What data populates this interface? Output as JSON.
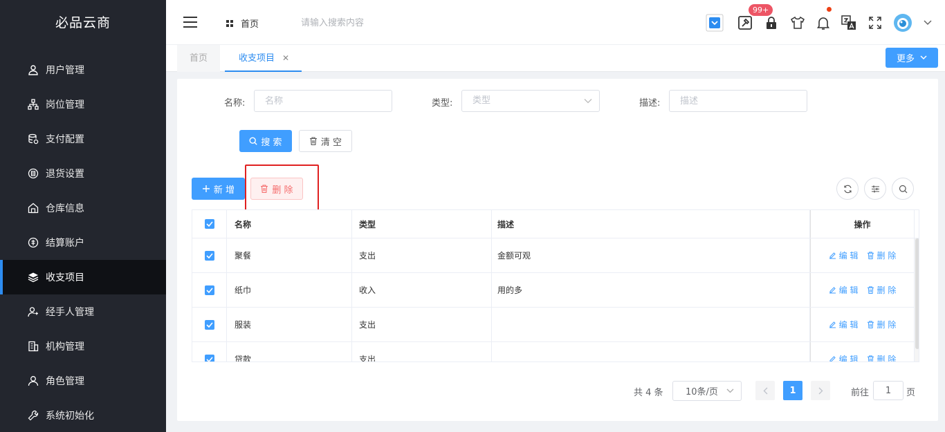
{
  "brand": "必品云商",
  "sidebar": {
    "items": [
      {
        "label": "用户管理",
        "icon": "user-icon"
      },
      {
        "label": "岗位管理",
        "icon": "org-icon"
      },
      {
        "label": "支付配置",
        "icon": "database-icon"
      },
      {
        "label": "退货设置",
        "icon": "return-icon"
      },
      {
        "label": "仓库信息",
        "icon": "warehouse-icon"
      },
      {
        "label": "结算账户",
        "icon": "account-icon"
      },
      {
        "label": "收支项目",
        "icon": "layers-icon",
        "active": true
      },
      {
        "label": "经手人管理",
        "icon": "handler-icon"
      },
      {
        "label": "机构管理",
        "icon": "building-icon"
      },
      {
        "label": "角色管理",
        "icon": "role-icon"
      },
      {
        "label": "系统初始化",
        "icon": "wrench-icon"
      }
    ]
  },
  "header": {
    "breadcrumb": "首页",
    "search_placeholder": "请输入搜索内容",
    "badge": "99+"
  },
  "tabs": {
    "items": [
      "首页",
      "收支项目"
    ],
    "active": "收支项目",
    "more_label": "更多"
  },
  "filters": {
    "name_label": "名称:",
    "name_placeholder": "名称",
    "type_label": "类型:",
    "type_placeholder": "类型",
    "desc_label": "描述:",
    "desc_placeholder": "描述",
    "search_button": "搜 索",
    "clear_button": "清 空"
  },
  "toolbar": {
    "add_button": "新 增",
    "delete_button": "删 除"
  },
  "table": {
    "columns": [
      "名称",
      "类型",
      "描述",
      "操作"
    ],
    "rows": [
      {
        "name": "聚餐",
        "type": "支出",
        "desc": "金额可观"
      },
      {
        "name": "纸巾",
        "type": "收入",
        "desc": "用的多"
      },
      {
        "name": "服装",
        "type": "支出",
        "desc": ""
      },
      {
        "name": "贷款",
        "type": "支出",
        "desc": ""
      }
    ],
    "edit_label": "编 辑",
    "delete_label": "删 除"
  },
  "pagination": {
    "total": "共 4 条",
    "page_size": "10条/页",
    "current_page": "1",
    "goto_label": "前往",
    "goto_value": "1",
    "goto_suffix": "页"
  },
  "colors": {
    "primary": "#409eff",
    "sidebar_bg": "#23262e",
    "danger": "#f56c6c",
    "highlight": "#e02020"
  }
}
